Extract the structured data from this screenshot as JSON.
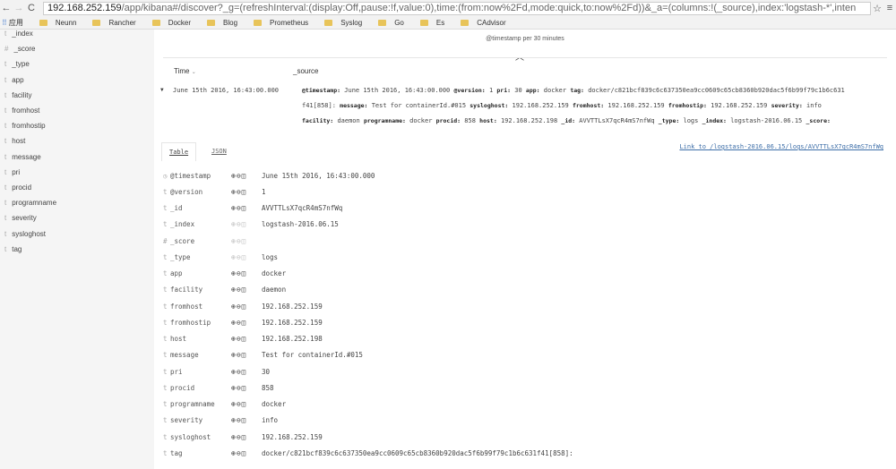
{
  "browser": {
    "url_host": "192.168.252.159",
    "url_rest": "/app/kibana#/discover?_g=(refreshInterval:(display:Off,pause:!f,value:0),time:(from:now%2Fd,mode:quick,to:now%2Fd))&_a=(columns:!(_source),index:'logstash-*',inten",
    "apps_label": "应用",
    "bookmarks": [
      "Neunn",
      "Rancher",
      "Docker",
      "Blog",
      "Prometheus",
      "Syslog",
      "Go",
      "Es",
      "CAdvisor"
    ]
  },
  "sidebar": {
    "fields": [
      {
        "type": "t",
        "name": "_index"
      },
      {
        "type": "#",
        "name": "_score"
      },
      {
        "type": "t",
        "name": "_type"
      },
      {
        "type": "t",
        "name": "app"
      },
      {
        "type": "t",
        "name": "facility"
      },
      {
        "type": "t",
        "name": "fromhost"
      },
      {
        "type": "t",
        "name": "fromhostip"
      },
      {
        "type": "t",
        "name": "host"
      },
      {
        "type": "t",
        "name": "message"
      },
      {
        "type": "t",
        "name": "pri"
      },
      {
        "type": "t",
        "name": "procid"
      },
      {
        "type": "t",
        "name": "programname"
      },
      {
        "type": "t",
        "name": "severity"
      },
      {
        "type": "t",
        "name": "sysloghost"
      },
      {
        "type": "t",
        "name": "tag"
      }
    ]
  },
  "main": {
    "histogram_label": "@timestamp per 30 minutes",
    "columns": {
      "time": "Time",
      "source": "_source"
    },
    "row": {
      "time": "June 15th 2016, 16:43:00.000",
      "source_lines": [
        [
          [
            "@timestamp:",
            "June 15th 2016, 16:43:00.000"
          ],
          [
            "@version:",
            "1"
          ],
          [
            "pri:",
            "30"
          ],
          [
            "app:",
            "docker"
          ],
          [
            "tag:",
            "docker/c821bcf839c6c637350ea9cc0609c65cb8360b920dac5f6b99f79c1b6c631"
          ]
        ],
        [
          [
            "",
            "f41[858]:"
          ],
          [
            "message:",
            " Test for containerId.#015"
          ],
          [
            "sysloghost:",
            "192.168.252.159"
          ],
          [
            "fromhost:",
            "192.168.252.159"
          ],
          [
            "fromhostip:",
            "192.168.252.159"
          ],
          [
            "severity:",
            "info"
          ]
        ],
        [
          [
            "facility:",
            "daemon"
          ],
          [
            "programname:",
            "docker"
          ],
          [
            "procid:",
            "858"
          ],
          [
            "host:",
            "192.168.252.198"
          ],
          [
            "_id:",
            "AVVTTLsX7qcR4mS7nfWq"
          ],
          [
            "_type:",
            "logs"
          ],
          [
            "_index:",
            "logstash-2016.06.15"
          ],
          [
            "_score:",
            ""
          ]
        ]
      ]
    },
    "tabs": [
      "Table",
      "JSON"
    ],
    "link": "Link to /logstash-2016.06.15/logs/AVVTTLsX7qcR4mS7nfWq",
    "details": [
      {
        "type": "◷",
        "field": "@timestamp",
        "value": "June 15th 2016, 16:43:00.000",
        "enabled": true
      },
      {
        "type": "t",
        "field": "@version",
        "value": "1",
        "enabled": true
      },
      {
        "type": "t",
        "field": "_id",
        "value": "AVVTTLsX7qcR4mS7nfWq",
        "enabled": true
      },
      {
        "type": "t",
        "field": "_index",
        "value": "logstash-2016.06.15",
        "enabled": false
      },
      {
        "type": "#",
        "field": "_score",
        "value": "",
        "enabled": false
      },
      {
        "type": "t",
        "field": "_type",
        "value": "logs",
        "enabled": false
      },
      {
        "type": "t",
        "field": "app",
        "value": "docker",
        "enabled": true
      },
      {
        "type": "t",
        "field": "facility",
        "value": "daemon",
        "enabled": true
      },
      {
        "type": "t",
        "field": "fromhost",
        "value": "192.168.252.159",
        "enabled": true
      },
      {
        "type": "t",
        "field": "fromhostip",
        "value": "192.168.252.159",
        "enabled": true
      },
      {
        "type": "t",
        "field": "host",
        "value": "192.168.252.198",
        "enabled": true
      },
      {
        "type": "t",
        "field": "message",
        "value": " Test for containerId.#015",
        "enabled": true
      },
      {
        "type": "t",
        "field": "pri",
        "value": "30",
        "enabled": true
      },
      {
        "type": "t",
        "field": "procid",
        "value": "858",
        "enabled": true
      },
      {
        "type": "t",
        "field": "programname",
        "value": "docker",
        "enabled": true
      },
      {
        "type": "t",
        "field": "severity",
        "value": "info",
        "enabled": true
      },
      {
        "type": "t",
        "field": "sysloghost",
        "value": "192.168.252.159",
        "enabled": true
      },
      {
        "type": "t",
        "field": "tag",
        "value": "docker/c821bcf839c6c637350ea9cc0609c65cb8360b920dac5f6b99f79c1b6c631f41[858]:",
        "enabled": true
      }
    ]
  }
}
